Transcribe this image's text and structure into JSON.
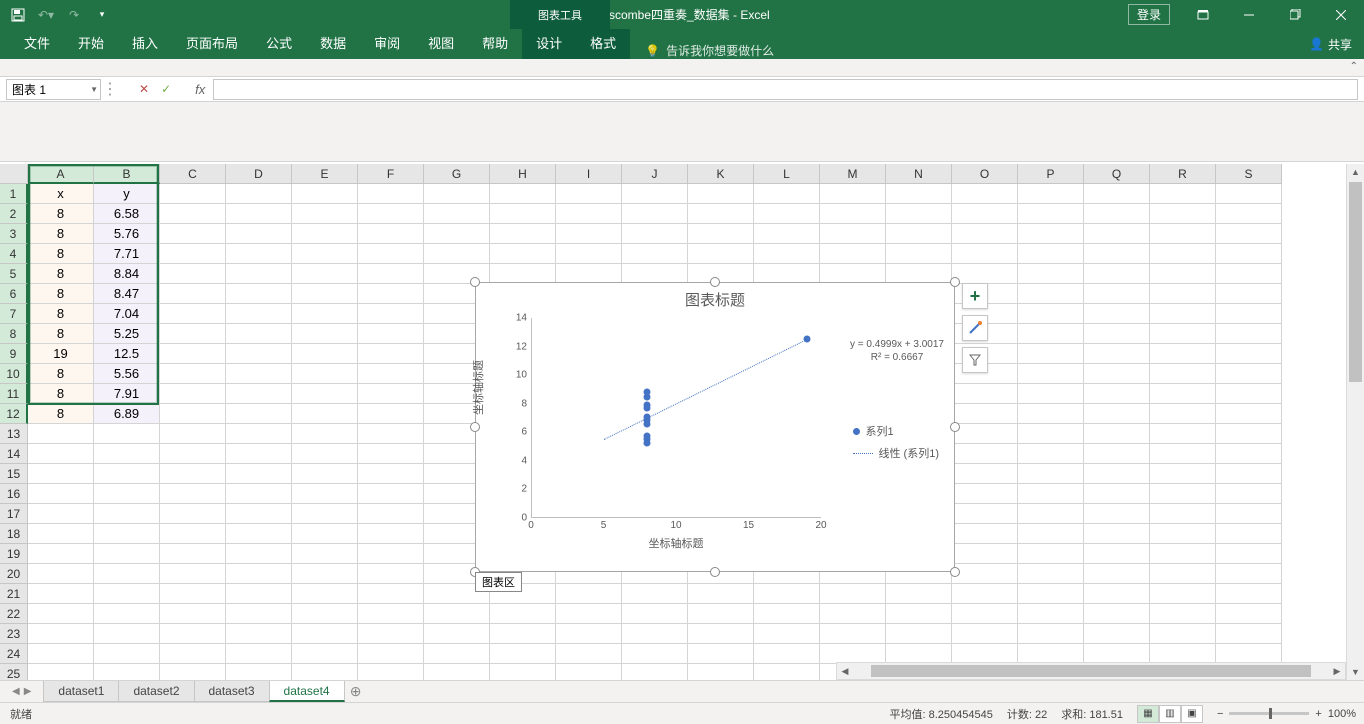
{
  "title": {
    "doc": "Anscombe四重奏_数据集  -  Excel",
    "chart_tools": "图表工具",
    "login": "登录"
  },
  "ribbon": {
    "tabs": [
      "文件",
      "开始",
      "插入",
      "页面布局",
      "公式",
      "数据",
      "审阅",
      "视图",
      "帮助",
      "设计",
      "格式"
    ],
    "tell_me": "告诉我你想要做什么",
    "share": "共享"
  },
  "name_box": "图表 1",
  "columns": [
    "A",
    "B",
    "C",
    "D",
    "E",
    "F",
    "G",
    "H",
    "I",
    "J",
    "K",
    "L",
    "M",
    "N",
    "O",
    "P",
    "Q",
    "R",
    "S"
  ],
  "headers": {
    "a": "x",
    "b": "y"
  },
  "data_rows": [
    {
      "a": "8",
      "b": "6.58"
    },
    {
      "a": "8",
      "b": "5.76"
    },
    {
      "a": "8",
      "b": "7.71"
    },
    {
      "a": "8",
      "b": "8.84"
    },
    {
      "a": "8",
      "b": "8.47"
    },
    {
      "a": "8",
      "b": "7.04"
    },
    {
      "a": "8",
      "b": "5.25"
    },
    {
      "a": "19",
      "b": "12.5"
    },
    {
      "a": "8",
      "b": "5.56"
    },
    {
      "a": "8",
      "b": "7.91"
    },
    {
      "a": "8",
      "b": "6.89"
    }
  ],
  "chart": {
    "title": "图表标题",
    "y_axis_title": "坐标轴标题",
    "x_axis_title": "坐标轴标题",
    "equation_line1": "y = 0.4999x + 3.0017",
    "equation_line2": "R² = 0.6667",
    "legend_series": "系列1",
    "legend_trend": "线性 (系列1)",
    "area_label": "图表区"
  },
  "chart_data": {
    "type": "scatter",
    "x": [
      8,
      8,
      8,
      8,
      8,
      8,
      8,
      19,
      8,
      8,
      8
    ],
    "y": [
      6.58,
      5.76,
      7.71,
      8.84,
      8.47,
      7.04,
      5.25,
      12.5,
      5.56,
      7.91,
      6.89
    ],
    "xlim": [
      0,
      20
    ],
    "ylim": [
      0,
      14
    ],
    "x_ticks": [
      0,
      5,
      10,
      15,
      20
    ],
    "y_ticks": [
      0,
      2,
      4,
      6,
      8,
      10,
      12,
      14
    ],
    "trend": {
      "slope": 0.4999,
      "intercept": 3.0017,
      "r2": 0.6667
    },
    "title": "图表标题",
    "xlabel": "坐标轴标题",
    "ylabel": "坐标轴标题",
    "series": [
      {
        "name": "系列1"
      },
      {
        "name": "线性 (系列1)"
      }
    ]
  },
  "sheets": {
    "tabs": [
      "dataset1",
      "dataset2",
      "dataset3",
      "dataset4"
    ],
    "active": 3
  },
  "status": {
    "ready": "就绪",
    "avg_label": "平均值:",
    "avg": "8.250454545",
    "count_label": "计数:",
    "count": "22",
    "sum_label": "求和:",
    "sum": "181.51",
    "zoom": "100%"
  }
}
